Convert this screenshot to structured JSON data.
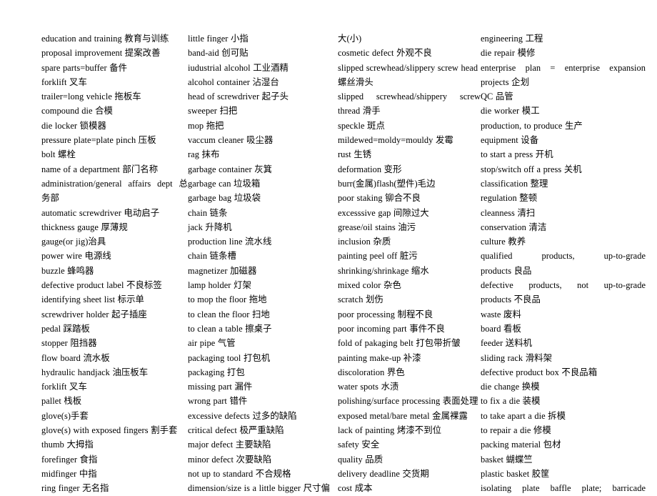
{
  "document": {
    "type": "glossary",
    "title": "English-Chinese Factory / Manufacturing Terminology Glossary",
    "background_color": "#ffffff",
    "text_color": "#000000",
    "column_count": 4
  },
  "columns": [
    {
      "index": 0,
      "entries": [
        {
          "text": "education and training 教育与训练",
          "justified": false
        },
        {
          "text": "proposal improvement 提案改善",
          "justified": false
        },
        {
          "text": "spare parts=buffer 备件",
          "justified": false
        },
        {
          "text": "forklift 叉车",
          "justified": false
        },
        {
          "text": "trailer=long vehicle 拖板车",
          "justified": false
        },
        {
          "text": "compound die 合模",
          "justified": false
        },
        {
          "text": "die locker 锁模器",
          "justified": false
        },
        {
          "text": "pressure plate=plate pinch 压板",
          "justified": false
        },
        {
          "text": "bolt 螺栓",
          "justified": false
        },
        {
          "text": "name of a department 部门名称",
          "justified": false
        },
        {
          "text": "administration/general affairs dept 总",
          "justified": true
        },
        {
          "text": "务部",
          "justified": false
        },
        {
          "text": "automatic screwdriver 电动启子",
          "justified": false
        },
        {
          "text": "thickness gauge 厚薄规",
          "justified": false
        },
        {
          "text": "gauge(or jig)治具",
          "justified": false
        },
        {
          "text": "power wire 电源线",
          "justified": false
        },
        {
          "text": "buzzle 蜂鸣器",
          "justified": false
        },
        {
          "text": "defective product label 不良标签",
          "justified": false
        },
        {
          "text": "identifying sheet list 标示单",
          "justified": false
        },
        {
          "text": "screwdriver holder 起子插座",
          "justified": false
        },
        {
          "text": "pedal 踩踏板",
          "justified": false
        },
        {
          "text": "stopper 阻挡器",
          "justified": false
        },
        {
          "text": "flow board 流水板",
          "justified": false
        },
        {
          "text": "hydraulic handjack 油压板车",
          "justified": false
        },
        {
          "text": "forklift 叉车",
          "justified": false
        },
        {
          "text": "pallet 栈板",
          "justified": false
        },
        {
          "text": "glove(s)手套",
          "justified": false
        },
        {
          "text": "glove(s) with exposed fingers 割手套",
          "justified": false
        },
        {
          "text": "thumb 大拇指",
          "justified": false
        },
        {
          "text": "forefinger 食指",
          "justified": false
        },
        {
          "text": "midfinger 中指",
          "justified": false
        },
        {
          "text": "ring finger 无名指",
          "justified": false
        }
      ]
    },
    {
      "index": 1,
      "entries": [
        {
          "text": "little finger 小指",
          "justified": false
        },
        {
          "text": "band-aid 创可贴",
          "justified": false
        },
        {
          "text": "iudustrial alcohol 工业酒精",
          "justified": false
        },
        {
          "text": "alcohol container 沾湿台",
          "justified": false
        },
        {
          "text": "head of screwdriver 起子头",
          "justified": false
        },
        {
          "text": "sweeper 扫把",
          "justified": false
        },
        {
          "text": "mop 拖把",
          "justified": false
        },
        {
          "text": "vaccum cleaner 吸尘器",
          "justified": false
        },
        {
          "text": "rag 抹布",
          "justified": false
        },
        {
          "text": "garbage container 灰箕",
          "justified": false
        },
        {
          "text": "garbage can 垃圾箱",
          "justified": false
        },
        {
          "text": "garbage bag 垃圾袋",
          "justified": false
        },
        {
          "text": "chain 链条",
          "justified": false
        },
        {
          "text": "jack 升降机",
          "justified": false
        },
        {
          "text": "production line 流水线",
          "justified": false
        },
        {
          "text": "chain 链条槽",
          "justified": false
        },
        {
          "text": "magnetizer 加磁器",
          "justified": false
        },
        {
          "text": "lamp holder 灯架",
          "justified": false
        },
        {
          "text": "to mop the floor 拖地",
          "justified": false
        },
        {
          "text": "to clean the floor 扫地",
          "justified": false
        },
        {
          "text": "to clean a table 擦桌子",
          "justified": false
        },
        {
          "text": "air pipe 气管",
          "justified": false
        },
        {
          "text": "packaging tool 打包机",
          "justified": false
        },
        {
          "text": "packaging 打包",
          "justified": false
        },
        {
          "text": "missing part 漏件",
          "justified": false
        },
        {
          "text": "wrong part 错件",
          "justified": false
        },
        {
          "text": "excessive defects 过多的缺陷",
          "justified": false
        },
        {
          "text": "critical defect 极严重缺陷",
          "justified": false
        },
        {
          "text": "major defect 主要缺陷",
          "justified": false
        },
        {
          "text": "minor defect 次要缺陷",
          "justified": false
        },
        {
          "text": "not up to standard 不合规格",
          "justified": false
        },
        {
          "text": "dimension/size is a little bigger 尺寸偏",
          "justified": false
        }
      ]
    },
    {
      "index": 2,
      "entries": [
        {
          "text": "大(小)",
          "justified": false
        },
        {
          "text": "cosmetic defect 外观不良",
          "justified": false
        },
        {
          "text": "slipped screwhead/slippery screw head",
          "justified": false
        },
        {
          "text": "螺丝滑头",
          "justified": false
        },
        {
          "text": "slipped screwhead/shippery screw",
          "justified": true
        },
        {
          "text": "thread 滑手",
          "justified": false
        },
        {
          "text": "speckle 斑点",
          "justified": false
        },
        {
          "text": "mildewed=moldy=mouldy 发霉",
          "justified": false
        },
        {
          "text": "rust 生锈",
          "justified": false
        },
        {
          "text": "deformation 变形",
          "justified": false
        },
        {
          "text": "burr(金属)flash(塑件)毛边",
          "justified": false
        },
        {
          "text": "poor staking 铆合不良",
          "justified": false
        },
        {
          "text": "excesssive gap 间隙过大",
          "justified": false
        },
        {
          "text": "grease/oil stains 油污",
          "justified": false
        },
        {
          "text": "inclusion 杂质",
          "justified": false
        },
        {
          "text": "painting peel off 脏污",
          "justified": false
        },
        {
          "text": "shrinking/shrinkage 缩水",
          "justified": false
        },
        {
          "text": "mixed color 杂色",
          "justified": false
        },
        {
          "text": "scratch 划伤",
          "justified": false
        },
        {
          "text": "poor processing 制程不良",
          "justified": false
        },
        {
          "text": "poor incoming part 事件不良",
          "justified": false
        },
        {
          "text": "fold of pakaging belt 打包带折皱",
          "justified": false
        },
        {
          "text": "painting make-up 补漆",
          "justified": false
        },
        {
          "text": "discoloration 界色",
          "justified": false
        },
        {
          "text": "water spots 水渍",
          "justified": false
        },
        {
          "text": "polishing/surface processing 表面处理",
          "justified": false
        },
        {
          "text": "exposed metal/bare metal 金属裸露",
          "justified": false
        },
        {
          "text": "lack of painting 烤漆不到位",
          "justified": false
        },
        {
          "text": "safety 安全",
          "justified": false
        },
        {
          "text": "quality 品质",
          "justified": false
        },
        {
          "text": "delivery deadline 交货期",
          "justified": false
        },
        {
          "text": "cost 成本",
          "justified": false
        }
      ]
    },
    {
      "index": 3,
      "entries": [
        {
          "text": "engineering 工程",
          "justified": false
        },
        {
          "text": "die repair 模修",
          "justified": false
        },
        {
          "text": "enterprise plan = enterprise expansion",
          "justified": true
        },
        {
          "text": "projects 企划",
          "justified": false
        },
        {
          "text": "QC 品管",
          "justified": false
        },
        {
          "text": "die worker 模工",
          "justified": false
        },
        {
          "text": "production, to produce 生产",
          "justified": false
        },
        {
          "text": "equipment 设备",
          "justified": false
        },
        {
          "text": "to start a press 开机",
          "justified": false
        },
        {
          "text": "stop/switch off a press 关机",
          "justified": false
        },
        {
          "text": "classification 整理",
          "justified": false
        },
        {
          "text": "regulation 整顿",
          "justified": false
        },
        {
          "text": "cleanness 清扫",
          "justified": false
        },
        {
          "text": "conservation 清洁",
          "justified": false
        },
        {
          "text": "culture 教养",
          "justified": false
        },
        {
          "text": "qualified products, up-to-grade",
          "justified": true
        },
        {
          "text": "products 良品",
          "justified": false
        },
        {
          "text": "defective products, not up-to-grade",
          "justified": true
        },
        {
          "text": "products 不良品",
          "justified": false
        },
        {
          "text": "waste 废料",
          "justified": false
        },
        {
          "text": "board 看板",
          "justified": false
        },
        {
          "text": "feeder 送料机",
          "justified": false
        },
        {
          "text": "sliding rack 滑料架",
          "justified": false
        },
        {
          "text": "defective product box 不良品箱",
          "justified": false
        },
        {
          "text": "die change 换模",
          "justified": false
        },
        {
          "text": "to fix a die 装模",
          "justified": false
        },
        {
          "text": "to take apart a die 拆模",
          "justified": false
        },
        {
          "text": "to repair a die 修模",
          "justified": false
        },
        {
          "text": "packing material 包材",
          "justified": false
        },
        {
          "text": "basket 蝴蝶竺",
          "justified": false
        },
        {
          "text": "plastic basket 胶筐",
          "justified": false
        },
        {
          "text": "isolating plate baffle plate; barricade",
          "justified": true
        }
      ]
    }
  ]
}
